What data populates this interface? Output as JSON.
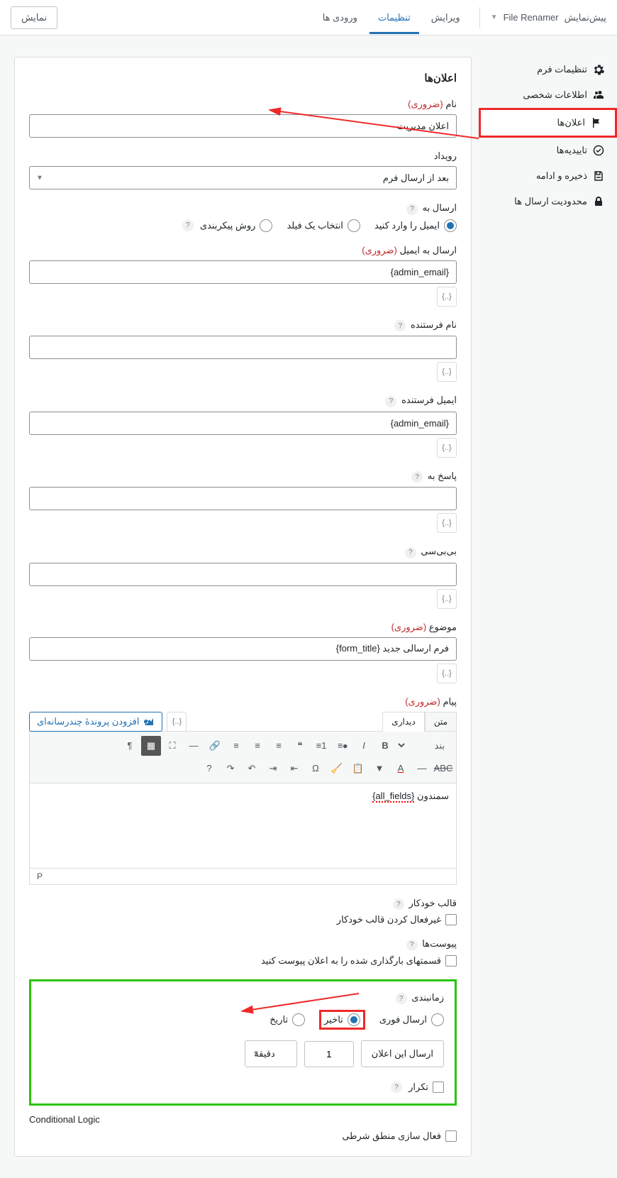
{
  "topbar": {
    "preview_label": "پیش‌نمایش",
    "form_name": "File Renamer",
    "tabs": {
      "edit": "ویرایش",
      "settings": "تنظیمات",
      "entries": "ورودی ها"
    },
    "display_btn": "نمایش"
  },
  "sidebar": {
    "form_settings": "تنظیمات فرم",
    "personal_data": "اطلاعات شخصی",
    "notifications": "اعلان‌ها",
    "confirmations": "تاییدیه‌ها",
    "save_continue": "ذخیره و ادامه",
    "submission_limit": "محدودیت ارسال ها"
  },
  "panel": {
    "title": "اعلان‌ها",
    "name_label": "نام",
    "required": "(ضروری)",
    "name_value": "اعلان مدیریت",
    "event_label": "رویداد",
    "event_value": "بعد از ارسال فرم",
    "send_to_label": "ارسال به",
    "send_to_options": {
      "email": "ایمیل را وارد کنید",
      "field": "انتخاب یک فیلد",
      "routing": "روش پیکربندی"
    },
    "send_to_email_label": "ارسال به ایمیل",
    "send_to_email_value": "{admin_email}",
    "from_name_label": "نام فرستنده",
    "from_email_label": "ایمیل فرستنده",
    "from_email_value": "{admin_email}",
    "reply_to_label": "پاسخ به",
    "bcc_label": "بی‌بی‌سی",
    "subject_label": "موضوع",
    "subject_value": "فرم ارسالی جدید {form_title}",
    "message_label": "پیام",
    "add_media": "افزودن پروندهٔ چندرسانه‌ای",
    "editor_tabs": {
      "visual": "دیداری",
      "text": "متن"
    },
    "format_select": "بند",
    "editor_content_left": "سمندون",
    "editor_content_right": "{all_fields}",
    "editor_path": "P",
    "auto_format_label": "قالب خودکار",
    "auto_format_check": "غیرفعال کردن قالب خودکار",
    "attachments_label": "پیوست‌ها",
    "attachments_check": "قسمتهای بارگذاری شده را به اعلان پیوست کنید",
    "scheduling_label": "زمانبندی",
    "scheduling_options": {
      "immediate": "ارسال فوری",
      "delay": "تاخیر",
      "date": "تاریخ"
    },
    "delay_send_label": "ارسال این اعلان",
    "delay_value": "1",
    "delay_unit": "دقیقه",
    "repeat_label": "تکرار",
    "conditional_title": "Conditional Logic",
    "conditional_check": "فعال سازی منطق شرطی",
    "merge_tag": "{..}"
  }
}
